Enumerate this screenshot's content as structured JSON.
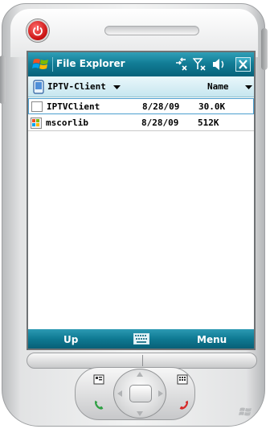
{
  "titlebar": {
    "title": "File Explorer",
    "start_icon": "windows-flag-icon",
    "status_icons": [
      "connectivity-icon",
      "no-signal-icon",
      "speaker-icon"
    ],
    "close_icon": "close-icon"
  },
  "folderbar": {
    "folder_name": "IPTV-Client",
    "sort_label": "Name"
  },
  "files": [
    {
      "icon": "document-icon",
      "name": "IPTVClient",
      "date": "8/28/09",
      "size": "30.0K",
      "selected": true
    },
    {
      "icon": "program-icon",
      "name": "mscorlib",
      "date": "8/28/09",
      "size": "512K",
      "selected": false
    }
  ],
  "softkeys": {
    "left": "Up",
    "right": "Menu",
    "center_icon": "keyboard-icon"
  },
  "colors": {
    "titlebar": "#127d96",
    "folderbar": "#d6eef5",
    "softbar": "#0f7a93",
    "power": "#c81010"
  }
}
